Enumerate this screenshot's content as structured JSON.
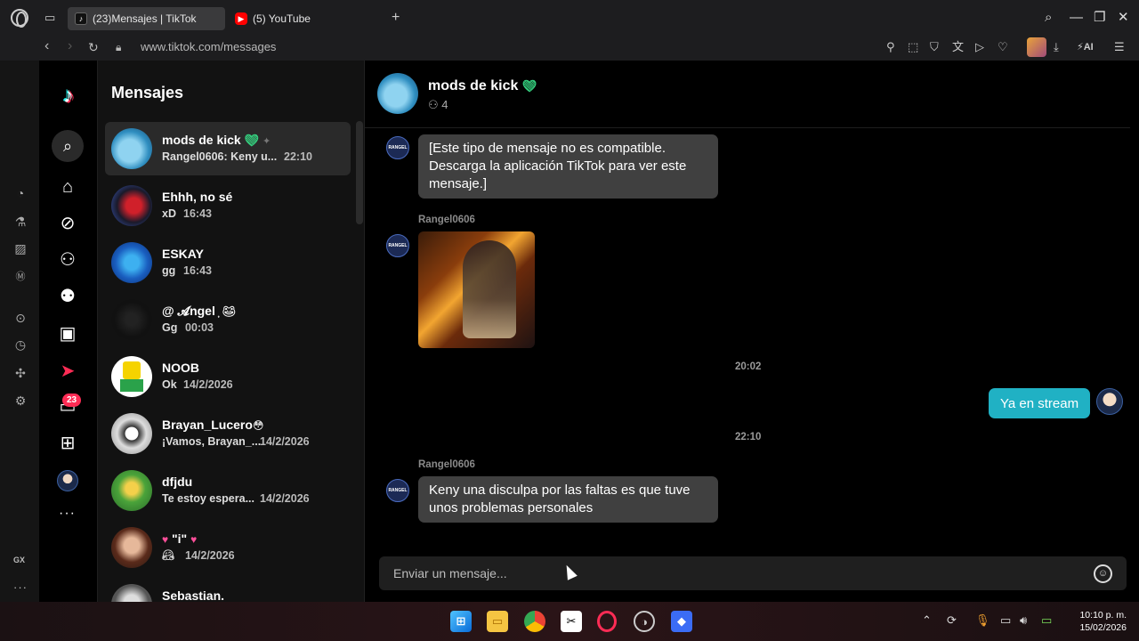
{
  "browser": {
    "tabs": [
      {
        "label": "(23)Mensajes | TikTok",
        "icon": "tiktok-favicon"
      },
      {
        "label": "(5) YouTube",
        "icon": "youtube-favicon"
      }
    ],
    "url": "www.tiktok.com/messages",
    "ai_label": "AI"
  },
  "tiktok_nav": {
    "badge": "23"
  },
  "conversations": {
    "title": "Mensajes",
    "items": [
      {
        "name": "mods de kick",
        "preview": "Rangel0606: Keny u...",
        "time": "22:10"
      },
      {
        "name": "Ehhh, no sé",
        "preview": "xD",
        "time": "16:43"
      },
      {
        "name": "ESKAY",
        "preview": "gg",
        "time": "16:43"
      },
      {
        "name": "@ 𝓐ngel ͎",
        "preview": "Gg",
        "time": "00:03"
      },
      {
        "name": "NOOB",
        "preview": "Ok",
        "time": "14/2/2026"
      },
      {
        "name": "Brayan_Lucero",
        "preview": "¡Vamos, Brayan_...",
        "time": "14/2/2026"
      },
      {
        "name": "dfjdu",
        "preview": "Te estoy espera...",
        "time": "14/2/2026"
      },
      {
        "name": "\"i\"",
        "preview": "",
        "time": "14/2/2026"
      },
      {
        "name": "Sebastian.",
        "preview": "",
        "time": ""
      }
    ]
  },
  "chat": {
    "group_name": "mods de kick",
    "member_count": "4",
    "messages": {
      "unsupported": "[Este tipo de mensaje no es compatible. Descarga la aplicación TikTok para ver este mensaje.]",
      "sender1": "Rangel0606",
      "ts1": "20:02",
      "mine": "Ya en stream",
      "ts2": "22:10",
      "sender2": "Rangel0606",
      "last": "Keny una disculpa por las faltas es que tuve unos problemas personales"
    },
    "composer_placeholder": "Enviar un mensaje..."
  },
  "taskbar": {
    "time": "10:10 p. m.",
    "date": "15/02/2026"
  },
  "colors": {
    "accent_tiktok": "#fe2c55",
    "my_bubble": "#20b1c4",
    "other_bubble": "#404040"
  }
}
